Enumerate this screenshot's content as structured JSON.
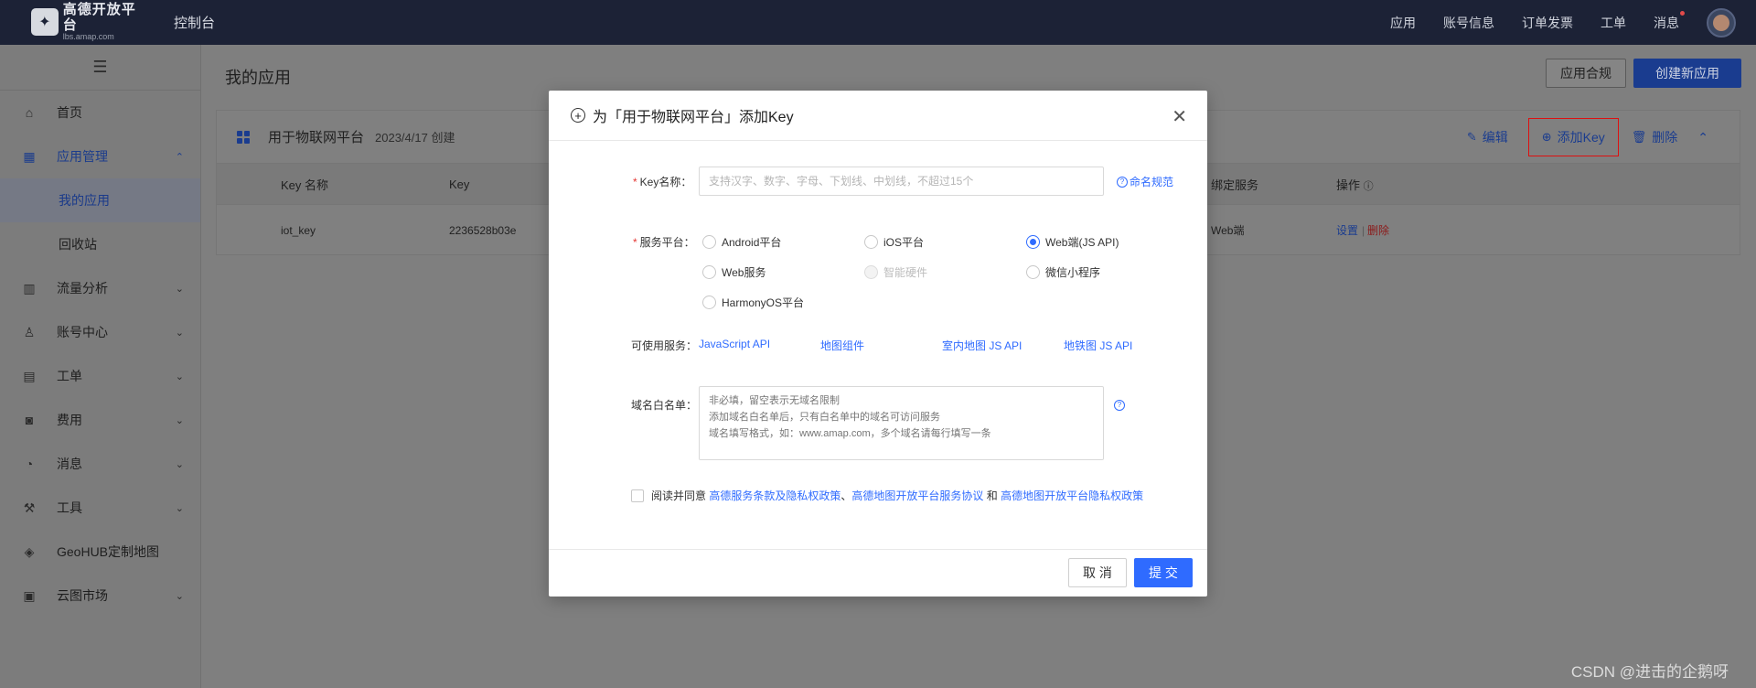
{
  "header": {
    "logo_text": "高德开放平台",
    "logo_sub": "lbs.amap.com",
    "console": "控制台",
    "nav": [
      "应用",
      "账号信息",
      "订单发票",
      "工单",
      "消息"
    ]
  },
  "sidebar": {
    "menu_icon": "☰",
    "items": [
      {
        "label": "首页"
      },
      {
        "label": "应用管理"
      },
      {
        "label": "我的应用"
      },
      {
        "label": "回收站"
      },
      {
        "label": "流量分析"
      },
      {
        "label": "账号中心"
      },
      {
        "label": "工单"
      },
      {
        "label": "费用"
      },
      {
        "label": "消息"
      },
      {
        "label": "工具"
      },
      {
        "label": "GeoHUB定制地图"
      },
      {
        "label": "云图市场"
      }
    ]
  },
  "main": {
    "title": "我的应用",
    "compliance_btn": "应用合规",
    "create_btn": "创建新应用",
    "app": {
      "name": "用于物联网平台",
      "date": "2023/4/17 创建",
      "actions": {
        "edit": "编辑",
        "add_key": "添加Key",
        "delete": "删除"
      }
    },
    "table": {
      "headers": [
        "Key 名称",
        "Key",
        "绑定服务",
        "操作"
      ],
      "row": {
        "name": "iot_key",
        "key": "2236528b03e",
        "service": "Web端",
        "settings": "设置",
        "delete": "删除"
      }
    }
  },
  "modal": {
    "title": "为「用于物联网平台」添加Key",
    "key_label": "Key名称：",
    "key_placeholder": "支持汉字、数字、字母、下划线、中划线，不超过15个",
    "naming_rule": "命名规范",
    "platform_label": "服务平台：",
    "platforms": [
      {
        "label": "Android平台",
        "state": "unchecked"
      },
      {
        "label": "iOS平台",
        "state": "unchecked"
      },
      {
        "label": "Web端(JS API)",
        "state": "checked"
      },
      {
        "label": "Web服务",
        "state": "unchecked"
      },
      {
        "label": "智能硬件",
        "state": "disabled"
      },
      {
        "label": "微信小程序",
        "state": "unchecked"
      },
      {
        "label": "HarmonyOS平台",
        "state": "unchecked"
      }
    ],
    "available_label": "可使用服务：",
    "services": [
      "JavaScript API",
      "地图组件",
      "室内地图 JS API",
      "地铁图 JS API"
    ],
    "domain_label": "域名白名单：",
    "domain_placeholder": "非必填，留空表示无域名限制\n添加域名白名单后，只有白名单中的域名可访问服务\n域名填写格式，如：www.amap.com，多个域名请每行填写一条",
    "agree_prefix": "阅读并同意",
    "agree_link1": "高德服务条款及隐私权政策",
    "agree_sep": "、",
    "agree_link2": "高德地图开放平台服务协议",
    "agree_and": "和",
    "agree_link3": "高德地图开放平台隐私权政策",
    "cancel": "取 消",
    "submit": "提 交"
  },
  "watermark": "CSDN @进击的企鹅呀",
  "colors": {
    "primary": "#2f6bff",
    "topbar": "#1c2236",
    "danger": "#e53935"
  }
}
